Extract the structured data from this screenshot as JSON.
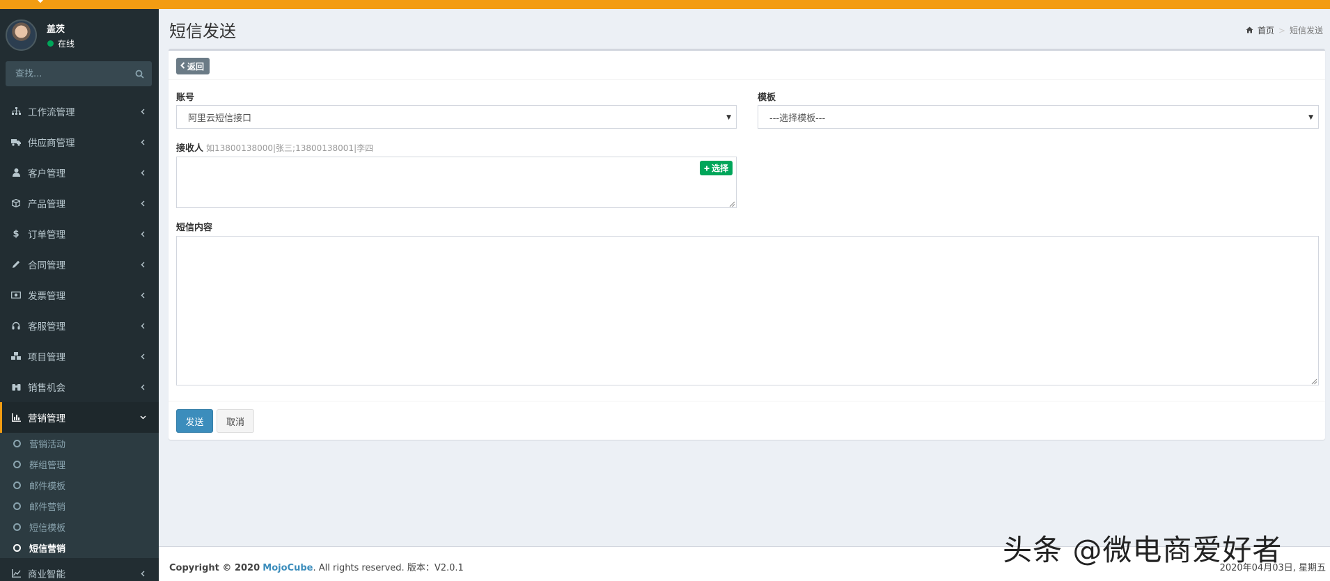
{
  "sidebar": {
    "user": {
      "name": "盖茨",
      "status": "在线"
    },
    "search_placeholder": "查找...",
    "menu": [
      {
        "label": "工作流管理",
        "icon": "sitemap-icon"
      },
      {
        "label": "供应商管理",
        "icon": "truck-icon"
      },
      {
        "label": "客户管理",
        "icon": "user-icon"
      },
      {
        "label": "产品管理",
        "icon": "cube-icon"
      },
      {
        "label": "订单管理",
        "icon": "dollar-icon"
      },
      {
        "label": "合同管理",
        "icon": "pencil-icon"
      },
      {
        "label": "发票管理",
        "icon": "money-icon"
      },
      {
        "label": "客服管理",
        "icon": "headphones-icon"
      },
      {
        "label": "项目管理",
        "icon": "cubes-icon"
      },
      {
        "label": "销售机会",
        "icon": "binoculars-icon"
      },
      {
        "label": "营销管理",
        "icon": "bar-chart-icon"
      },
      {
        "label": "商业智能",
        "icon": "line-chart-icon"
      }
    ],
    "submenu": [
      {
        "label": "营销活动"
      },
      {
        "label": "群组管理"
      },
      {
        "label": "邮件模板"
      },
      {
        "label": "邮件营销"
      },
      {
        "label": "短信模板"
      },
      {
        "label": "短信营销"
      }
    ]
  },
  "header": {
    "title": "短信发送",
    "breadcrumb_home": "首页",
    "breadcrumb_current": "短信发送"
  },
  "form": {
    "back_label": "返回",
    "account_label": "账号",
    "account_value": "阿里云短信接口",
    "template_label": "模板",
    "template_value": "---选择模板---",
    "recipient_label": "接收人",
    "recipient_hint": "如13800138000|张三;13800138001|李四",
    "choose_label": "选择",
    "content_label": "短信内容",
    "send_label": "发送",
    "cancel_label": "取消"
  },
  "footer": {
    "copyright_prefix": "Copyright © 2020",
    "brand": "MojoCube",
    "copyright_suffix": ". All rights reserved. 版本：V2.0.1",
    "date": "2020年04月03日, 星期五"
  },
  "watermark": "头条 @微电商爱好者",
  "colors": {
    "accent": "#f39c12",
    "sidebar": "#222d32",
    "primary": "#3c8dbc",
    "success": "#00a65a"
  }
}
